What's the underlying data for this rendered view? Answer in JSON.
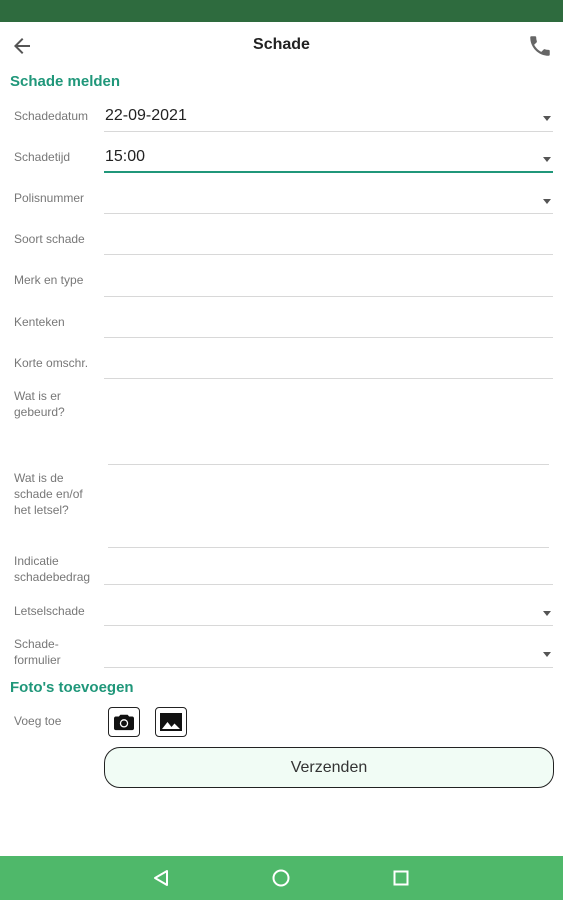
{
  "app_bar": {
    "title": "Schade",
    "back_icon": "arrow-back-icon",
    "phone_icon": "phone-icon"
  },
  "form": {
    "section_title": "Schade melden",
    "fields": {
      "schadedatum": {
        "label": "Schadedatum",
        "value": "22-09-2021"
      },
      "schadetijd": {
        "label": "Schadetijd",
        "value": "15:00"
      },
      "polisnummer": {
        "label": "Polisnummer",
        "value": ""
      },
      "soort_schade": {
        "label": "Soort schade",
        "value": ""
      },
      "merk_type": {
        "label": "Merk en type",
        "value": ""
      },
      "kenteken": {
        "label": "Kenteken",
        "value": ""
      },
      "korte_omschr": {
        "label": "Korte omschr.",
        "value": ""
      },
      "wat_gebeurd": {
        "label": "Wat is er gebeurd?",
        "value": ""
      },
      "schade_letsel": {
        "label": "Wat is de schade en/of het letsel?",
        "value": ""
      },
      "indicatie": {
        "label": "Indicatie schadebedrag",
        "value": ""
      },
      "letselschade": {
        "label": "Letselschade",
        "value": ""
      },
      "schadeformulier": {
        "label": "Schade-formulier",
        "value": ""
      }
    }
  },
  "photos": {
    "section_title": "Foto's toevoegen",
    "add_label": "Voeg toe",
    "camera_icon": "camera-icon",
    "gallery_icon": "image-icon"
  },
  "submit_label": "Verzenden",
  "colors": {
    "status_bar": "#2e6b3e",
    "accent": "#20977a",
    "nav_bar": "#4fb86a",
    "button_fill": "#f1fcf5"
  },
  "nav": {
    "back_icon": "triangle-back-icon",
    "home_icon": "circle-home-icon",
    "recents_icon": "square-recents-icon"
  }
}
